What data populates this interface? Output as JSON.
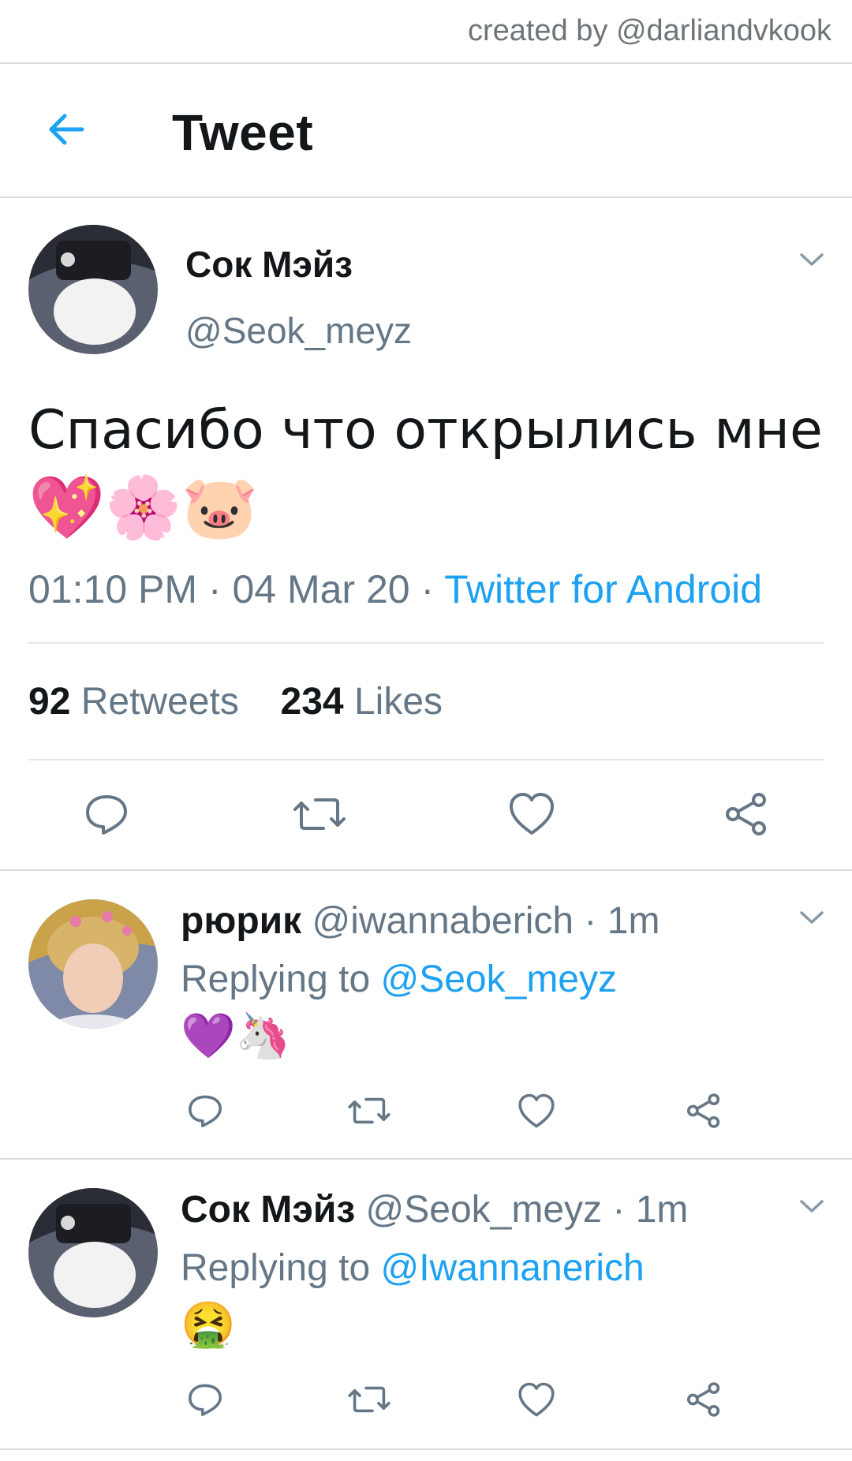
{
  "credit": "created by @darliandvkook",
  "header": {
    "title": "Tweet"
  },
  "main_tweet": {
    "name": "Сок Мэйз",
    "handle": "@Seok_meyz",
    "text": "Спасибо что открылись мне",
    "emojis": "💖🌸🐷",
    "time": "01:10 PM",
    "date": "04 Mar 20",
    "sep": " · ",
    "source": "Twitter for Android",
    "retweet_count": "92",
    "retweet_label": "Retweets",
    "like_count": "234",
    "like_label": "Likes"
  },
  "replies": [
    {
      "name": "рюрик",
      "handle": "@iwannaberich",
      "time": "1m",
      "replying_label": "Replying to",
      "replying_to": "@Seok_meyz",
      "text": "💜🦄"
    },
    {
      "name": "Сок Мэйз",
      "handle": "@Seok_meyz",
      "time": "1m",
      "replying_label": "Replying to",
      "replying_to": "@Iwannanerich",
      "text": "🤮"
    }
  ],
  "colors": {
    "accent": "#1da1f2",
    "secondary": "#657786",
    "divider": "#e1e5e9"
  }
}
